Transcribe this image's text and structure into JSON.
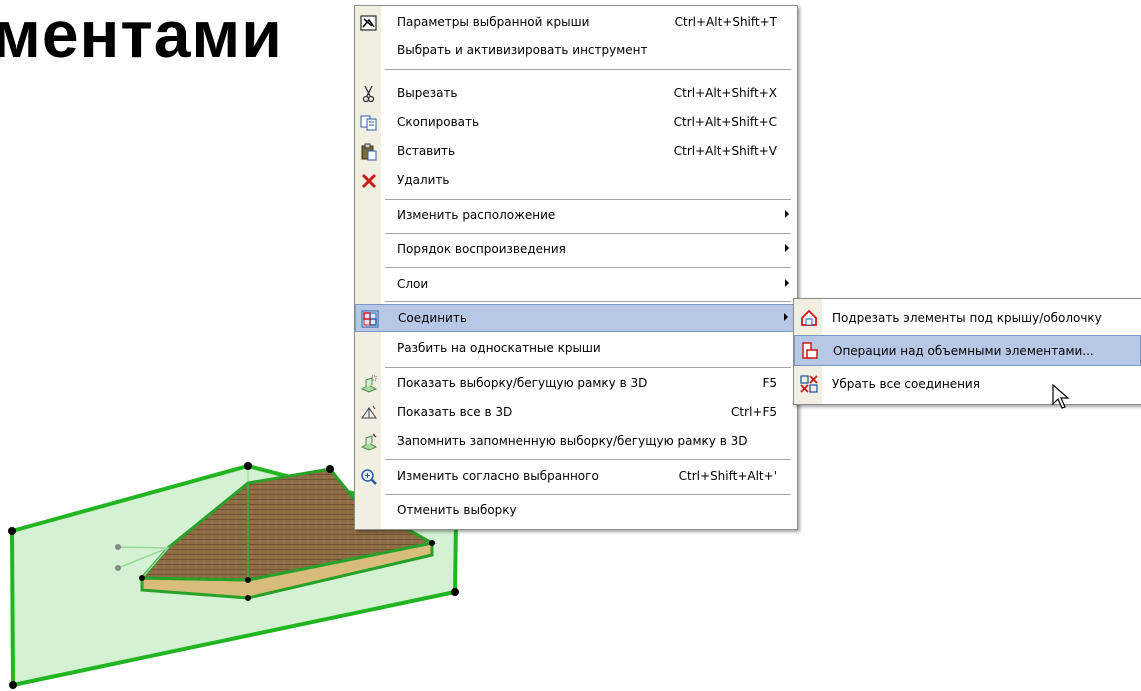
{
  "slide": {
    "title": "ментами"
  },
  "context_menu": {
    "items": [
      {
        "label": "Параметры выбранной крыши",
        "shortcut": "Ctrl+Alt+Shift+T",
        "icon": "roof-settings-icon"
      },
      {
        "label": "Выбрать и активизировать инструмент",
        "shortcut": "",
        "icon": ""
      },
      {
        "label": "Вырезать",
        "shortcut": "Ctrl+Alt+Shift+X",
        "icon": "scissors-icon"
      },
      {
        "label": "Скопировать",
        "shortcut": "Ctrl+Alt+Shift+C",
        "icon": "copy-icon"
      },
      {
        "label": "Вставить",
        "shortcut": "Ctrl+Alt+Shift+V",
        "icon": "paste-icon"
      },
      {
        "label": "Удалить",
        "shortcut": "",
        "icon": "delete-icon"
      },
      {
        "label": "Изменить расположение",
        "shortcut": "",
        "icon": "",
        "submenu": true
      },
      {
        "label": "Порядок воспроизведения",
        "shortcut": "",
        "icon": "",
        "submenu": true
      },
      {
        "label": "Слои",
        "shortcut": "",
        "icon": "",
        "submenu": true
      },
      {
        "label": "Соединить",
        "shortcut": "",
        "icon": "connect-icon",
        "submenu": true,
        "highlighted": true
      },
      {
        "label": "Разбить на односкатные крыши",
        "shortcut": "",
        "icon": ""
      },
      {
        "label": "Показать выборку/бегущую рамку в 3D",
        "shortcut": "F5",
        "icon": "show-selection-3d-icon"
      },
      {
        "label": "Показать все в 3D",
        "shortcut": "Ctrl+F5",
        "icon": "show-all-3d-icon"
      },
      {
        "label": "Запомнить запомненную выборку/бегущую рамку в 3D",
        "shortcut": "",
        "icon": "remember-selection-3d-icon"
      },
      {
        "label": "Изменить согласно выбранного",
        "shortcut": "Ctrl+Shift+Alt+'",
        "icon": "zoom-to-selection-icon"
      },
      {
        "label": "Отменить выборку",
        "shortcut": "",
        "icon": ""
      }
    ]
  },
  "submenu": {
    "items": [
      {
        "label": "Подрезать элементы под крышу/оболочку",
        "icon": "trim-to-roof-icon"
      },
      {
        "label": "Операции над объемными элементами...",
        "icon": "solid-operations-icon",
        "highlighted": true
      },
      {
        "label": "Убрать все соединения",
        "icon": "remove-connections-icon"
      }
    ]
  },
  "colors": {
    "highlight": "#b6c8e6",
    "highlight_border": "#7f98c3",
    "gutter": "#f1efe2",
    "wall_fill": "#c8ecc8",
    "wall_edge": "#21b521",
    "roof": "#8b6a43"
  }
}
